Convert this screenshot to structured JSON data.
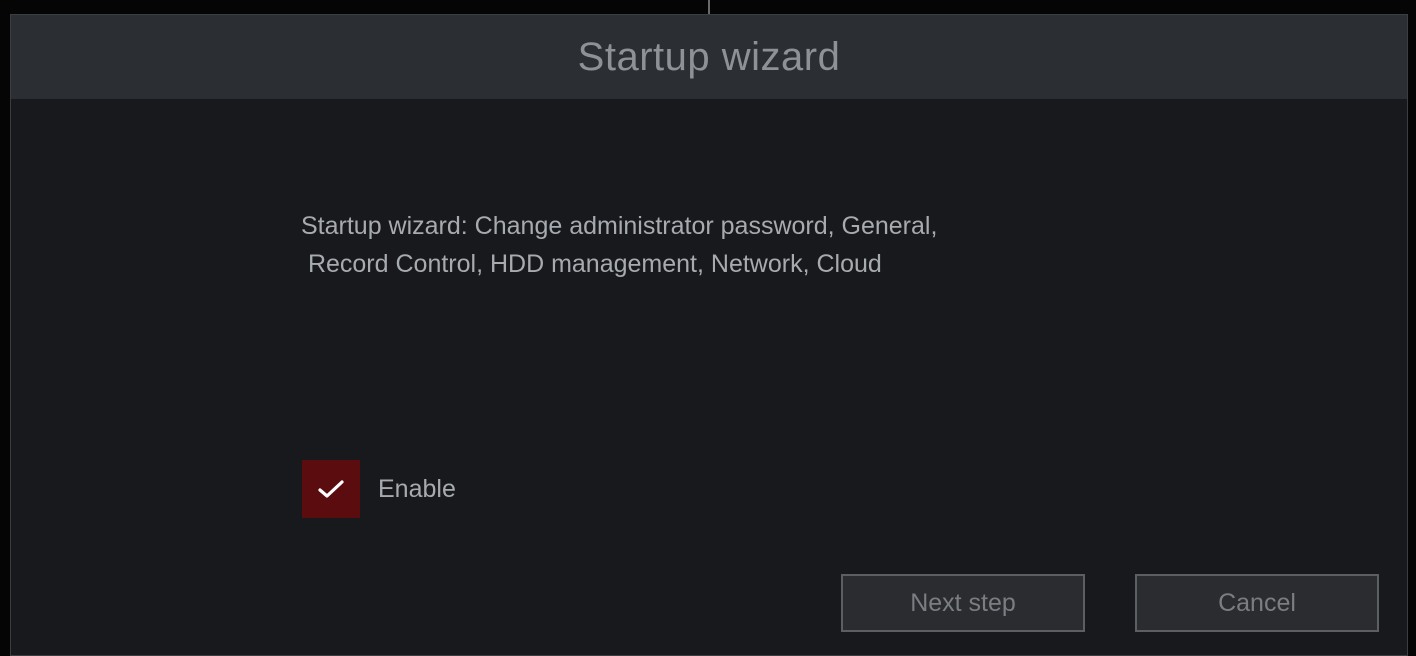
{
  "dialog": {
    "title": "Startup wizard",
    "description_lines": [
      "Startup wizard: Change administrator password, General,",
      " Record Control, HDD management, Network, Cloud"
    ],
    "enable": {
      "label": "Enable",
      "checked": true,
      "icon": "checkmark-icon"
    },
    "buttons": {
      "next_label": "Next step",
      "cancel_label": "Cancel"
    }
  },
  "colors": {
    "title_bar": "#2b2e33",
    "dialog_background": "#17191c",
    "checkbox_checked": "#5a0c0f",
    "text": "#a7aaaf"
  }
}
